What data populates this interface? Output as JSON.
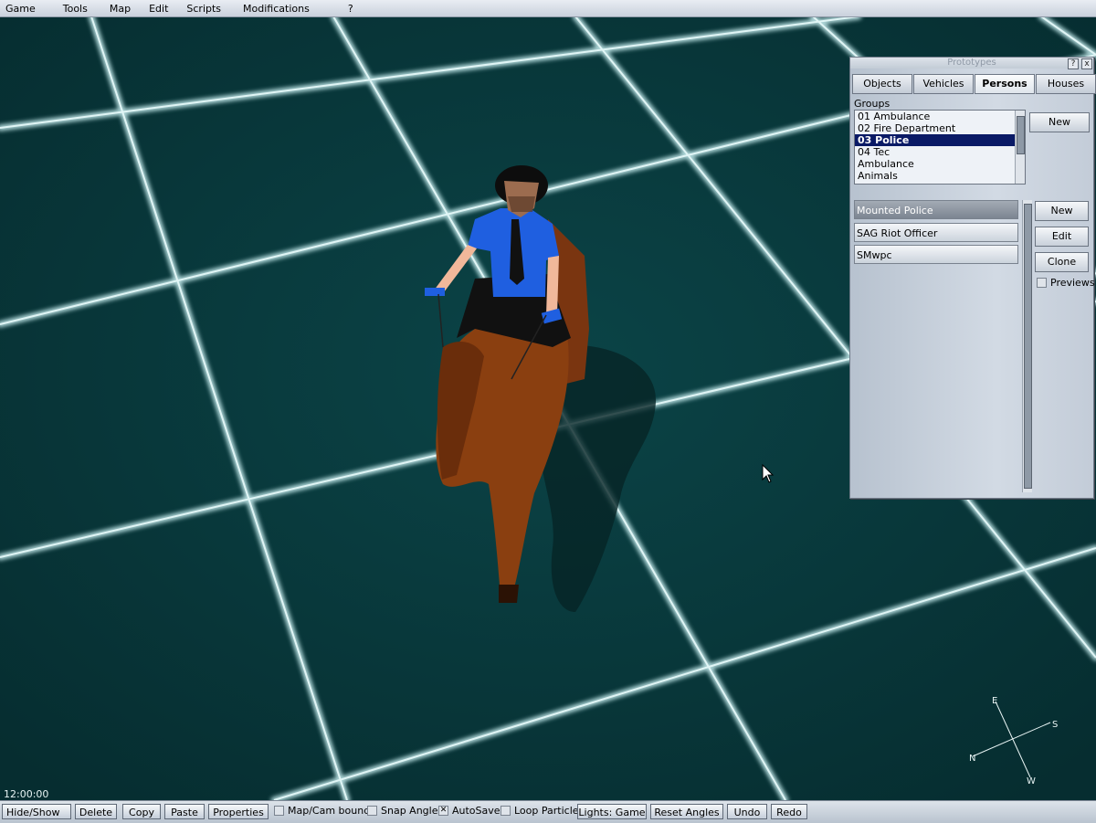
{
  "menu": [
    "Game",
    "Tools",
    "Map",
    "Edit",
    "Scripts",
    "Modifications",
    "?"
  ],
  "prototypes": {
    "title": "Prototypes",
    "help_label": "?",
    "close_label": "x",
    "tabs": [
      "Objects",
      "Vehicles",
      "Persons",
      "Houses"
    ],
    "active_tab": "Persons",
    "groups_label": "Groups",
    "groups": [
      "01 Ambulance",
      "02 Fire Department",
      "03 Police",
      "04 Tec",
      "Ambulance",
      "Animals"
    ],
    "selected_group": "03 Police",
    "group_new_label": "New",
    "items": [
      "Mounted Police",
      "SAG Riot Officer",
      "SMwpc"
    ],
    "selected_item": "Mounted Police",
    "actions": {
      "new": "New",
      "edit": "Edit",
      "clone": "Clone"
    },
    "previews_label": "Previews",
    "previews_checked": false
  },
  "time": "12:00:00",
  "compass": {
    "e": "E",
    "s": "S",
    "n": "N",
    "w": "W"
  },
  "toolbar": {
    "hide_show": "Hide/Show",
    "delete": "Delete",
    "copy": "Copy",
    "paste": "Paste",
    "properties": "Properties",
    "map_cam_bounds": "Map/Cam bounds",
    "map_cam_bounds_checked": false,
    "snap_angles": "Snap Angles",
    "snap_angles_checked": false,
    "autosave": "AutoSave",
    "autosave_checked": true,
    "loop_particles": "Loop Particles",
    "loop_particles_checked": false,
    "lights": "Lights: Game",
    "reset_angles": "Reset Angles",
    "undo": "Undo",
    "redo": "Redo"
  },
  "colors": {
    "ground": "#0a3a3d",
    "grid": "#bfe6e8",
    "selection": "#0a1a66",
    "horse": "#8a3f10",
    "uniform": "#1f5fe0"
  }
}
